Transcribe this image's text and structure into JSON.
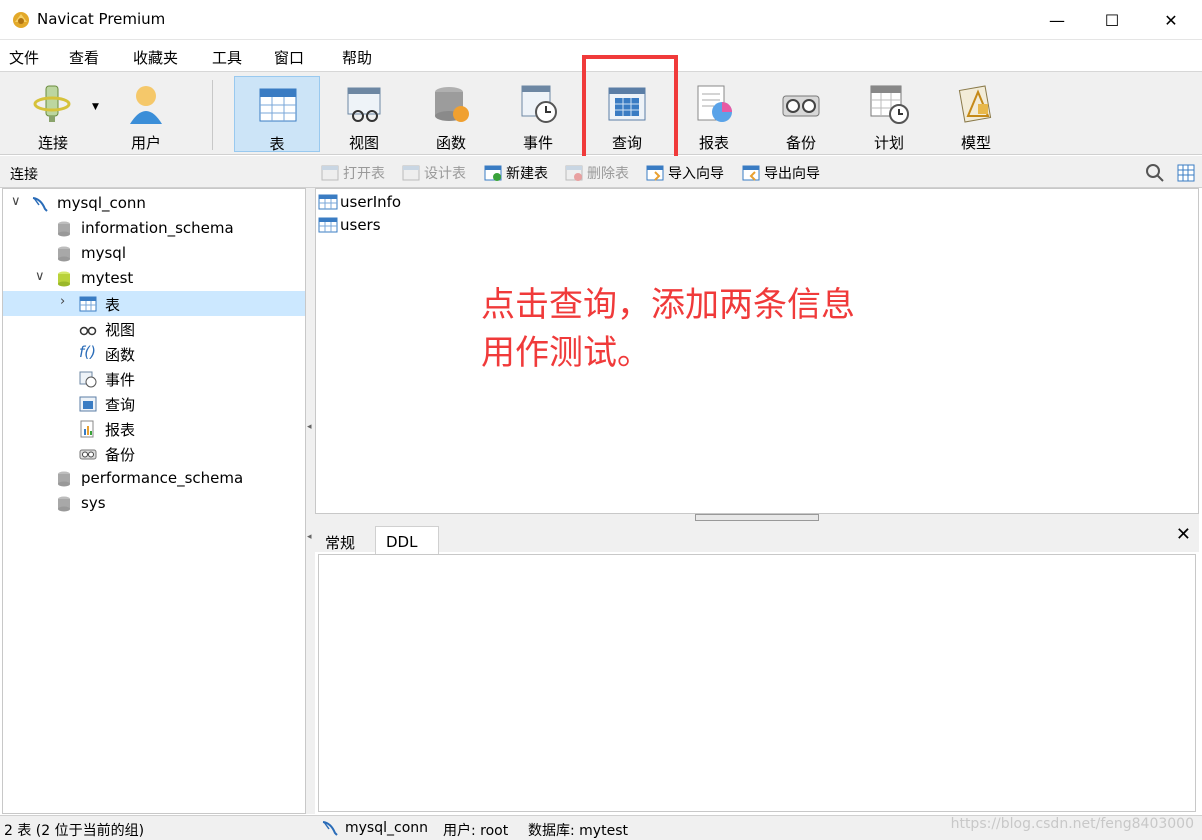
{
  "window": {
    "title": "Navicat Premium",
    "controls": {
      "minimize": "—",
      "maximize": "☐",
      "close": "✕"
    }
  },
  "menubar": [
    "文件",
    "查看",
    "收藏夹",
    "工具",
    "窗口",
    "帮助"
  ],
  "toolbar": {
    "buttons": [
      {
        "label": "连接",
        "icon": "connection-icon"
      },
      {
        "label": "用户",
        "icon": "user-icon"
      },
      {
        "label": "表",
        "icon": "table-icon",
        "active": true
      },
      {
        "label": "视图",
        "icon": "view-icon"
      },
      {
        "label": "函数",
        "icon": "function-icon"
      },
      {
        "label": "事件",
        "icon": "event-icon"
      },
      {
        "label": "查询",
        "icon": "query-icon",
        "highlighted": true
      },
      {
        "label": "报表",
        "icon": "report-icon"
      },
      {
        "label": "备份",
        "icon": "backup-icon"
      },
      {
        "label": "计划",
        "icon": "schedule-icon"
      },
      {
        "label": "模型",
        "icon": "model-icon"
      }
    ],
    "highlight_color": "#f03a3a",
    "active_color": "#cce4f7"
  },
  "subbar": {
    "connections_label": "连接",
    "actions": [
      {
        "label": "打开表",
        "enabled": false
      },
      {
        "label": "设计表",
        "enabled": false
      },
      {
        "label": "新建表",
        "enabled": true
      },
      {
        "label": "删除表",
        "enabled": false
      },
      {
        "label": "导入向导",
        "enabled": true
      },
      {
        "label": "导出向导",
        "enabled": true
      }
    ]
  },
  "tree": {
    "connection": "mysql_conn",
    "databases": [
      "information_schema",
      "mysql",
      "mytest",
      "performance_schema",
      "sys"
    ],
    "mytest_children": [
      "表",
      "视图",
      "函数",
      "事件",
      "查询",
      "报表",
      "备份"
    ],
    "selected": "表"
  },
  "objects": [
    "userInfo",
    "users"
  ],
  "annotation": {
    "line1": "点击查询，添加两条信息",
    "line2": "用作测试。",
    "color": "#f03a3a"
  },
  "bottom_tabs": [
    "常规",
    "DDL"
  ],
  "bottom_active_tab": "DDL",
  "panel_close": "✕",
  "status": {
    "left": "2 表 (2 位于当前的组)",
    "connection": "mysql_conn",
    "user": "用户: root",
    "database": "数据库: mytest"
  },
  "watermark": "https://blog.csdn.net/feng8403000"
}
